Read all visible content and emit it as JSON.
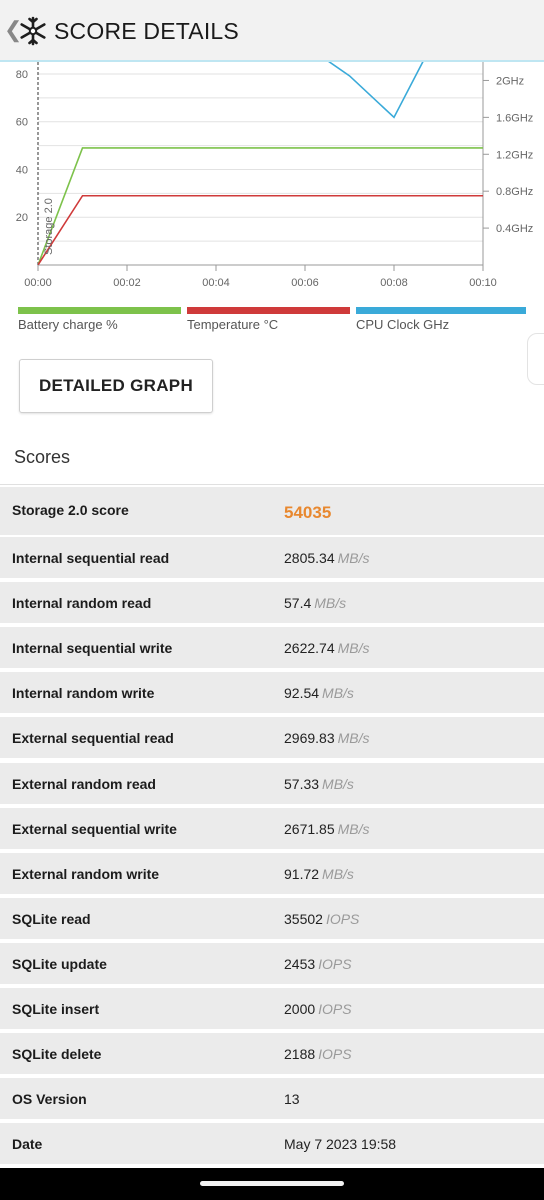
{
  "header": {
    "title": "SCORE DETAILS"
  },
  "chart_data": {
    "type": "line",
    "x_ticks": [
      "00:00",
      "00:02",
      "00:04",
      "00:06",
      "00:08",
      "00:10"
    ],
    "y_left_ticks": [
      "20",
      "40",
      "60",
      "80"
    ],
    "y_right_ticks": [
      "0.4GHz",
      "0.8GHz",
      "1.2GHz",
      "1.6GHz",
      "2GHz"
    ],
    "marker_label": "Storage 2.0",
    "xlim": [
      0,
      10
    ],
    "ylim_left": [
      0,
      85
    ],
    "ylim_right": [
      0,
      2.2
    ],
    "series": [
      {
        "name": "Battery charge %",
        "color": "#7dc24b",
        "axis": "left",
        "x": [
          0,
          1,
          10
        ],
        "y": [
          0,
          49,
          49
        ]
      },
      {
        "name": "Temperature °C",
        "color": "#cf3a3a",
        "axis": "left",
        "x": [
          0,
          1,
          10
        ],
        "y": [
          0,
          29,
          29
        ]
      },
      {
        "name": "CPU Clock GHz",
        "color": "#3aaad9",
        "axis": "right",
        "x": [
          6.4,
          7,
          8,
          8.7
        ],
        "y": [
          2.25,
          2.05,
          1.6,
          2.25
        ]
      }
    ]
  },
  "legend": {
    "battery": {
      "label": "Battery charge %",
      "color": "#7dc24b"
    },
    "temperature": {
      "label": "Temperature °C",
      "color": "#cf3a3a"
    },
    "cpu": {
      "label": "CPU Clock GHz",
      "color": "#3aaad9"
    }
  },
  "detailed_graph_label": "DETAILED GRAPH",
  "scores_title": "Scores",
  "scores": [
    {
      "name": "Storage 2.0 score",
      "value": "54035",
      "unit": ""
    },
    {
      "name": "Internal sequential read",
      "value": "2805.34",
      "unit": "MB/s"
    },
    {
      "name": "Internal random read",
      "value": "57.4",
      "unit": "MB/s"
    },
    {
      "name": "Internal sequential write",
      "value": "2622.74",
      "unit": "MB/s"
    },
    {
      "name": "Internal random write",
      "value": "92.54",
      "unit": "MB/s"
    },
    {
      "name": "External sequential read",
      "value": "2969.83",
      "unit": "MB/s"
    },
    {
      "name": "External random read",
      "value": "57.33",
      "unit": "MB/s"
    },
    {
      "name": "External sequential write",
      "value": "2671.85",
      "unit": "MB/s"
    },
    {
      "name": "External random write",
      "value": "91.72",
      "unit": "MB/s"
    },
    {
      "name": "SQLite read",
      "value": "35502",
      "unit": "IOPS"
    },
    {
      "name": "SQLite update",
      "value": "2453",
      "unit": "IOPS"
    },
    {
      "name": "SQLite insert",
      "value": "2000",
      "unit": "IOPS"
    },
    {
      "name": "SQLite delete",
      "value": "2188",
      "unit": "IOPS"
    },
    {
      "name": "OS Version",
      "value": "13",
      "unit": ""
    },
    {
      "name": "Date",
      "value": "May 7 2023 19:58",
      "unit": ""
    }
  ]
}
